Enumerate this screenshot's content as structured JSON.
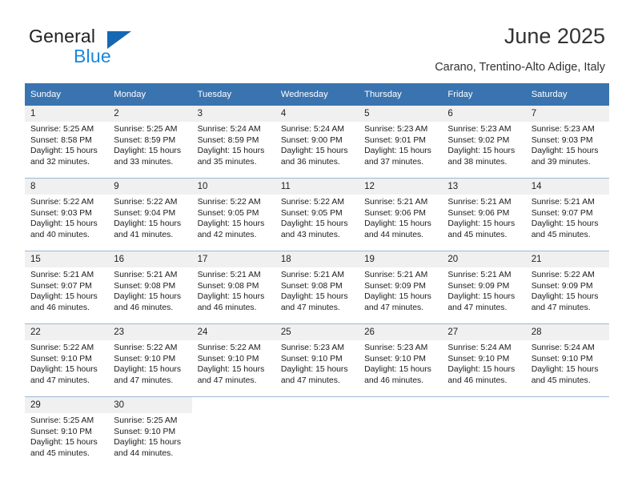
{
  "brand": {
    "name_top": "General",
    "name_bottom": "Blue",
    "triangle_color": "#1668b3",
    "blue_color": "#1a87db",
    "dark_color": "#231f20"
  },
  "header": {
    "title": "June 2025",
    "subtitle": "Carano, Trentino-Alto Adige, Italy"
  },
  "theme": {
    "header_blue": "#3a74b0",
    "daynum_band": "#f0f0f0",
    "row_border": "#9fb8d4"
  },
  "labels": {
    "sunrise_prefix": "Sunrise:",
    "sunset_prefix": "Sunset:",
    "daylight_prefix": "Daylight:"
  },
  "weekdays": [
    "Sunday",
    "Monday",
    "Tuesday",
    "Wednesday",
    "Thursday",
    "Friday",
    "Saturday"
  ],
  "weeks": [
    [
      {
        "day": "1",
        "sunrise": "Sunrise: 5:25 AM",
        "sunset": "Sunset: 8:58 PM",
        "daylight1": "Daylight: 15 hours",
        "daylight2": "and 32 minutes."
      },
      {
        "day": "2",
        "sunrise": "Sunrise: 5:25 AM",
        "sunset": "Sunset: 8:59 PM",
        "daylight1": "Daylight: 15 hours",
        "daylight2": "and 33 minutes."
      },
      {
        "day": "3",
        "sunrise": "Sunrise: 5:24 AM",
        "sunset": "Sunset: 8:59 PM",
        "daylight1": "Daylight: 15 hours",
        "daylight2": "and 35 minutes."
      },
      {
        "day": "4",
        "sunrise": "Sunrise: 5:24 AM",
        "sunset": "Sunset: 9:00 PM",
        "daylight1": "Daylight: 15 hours",
        "daylight2": "and 36 minutes."
      },
      {
        "day": "5",
        "sunrise": "Sunrise: 5:23 AM",
        "sunset": "Sunset: 9:01 PM",
        "daylight1": "Daylight: 15 hours",
        "daylight2": "and 37 minutes."
      },
      {
        "day": "6",
        "sunrise": "Sunrise: 5:23 AM",
        "sunset": "Sunset: 9:02 PM",
        "daylight1": "Daylight: 15 hours",
        "daylight2": "and 38 minutes."
      },
      {
        "day": "7",
        "sunrise": "Sunrise: 5:23 AM",
        "sunset": "Sunset: 9:03 PM",
        "daylight1": "Daylight: 15 hours",
        "daylight2": "and 39 minutes."
      }
    ],
    [
      {
        "day": "8",
        "sunrise": "Sunrise: 5:22 AM",
        "sunset": "Sunset: 9:03 PM",
        "daylight1": "Daylight: 15 hours",
        "daylight2": "and 40 minutes."
      },
      {
        "day": "9",
        "sunrise": "Sunrise: 5:22 AM",
        "sunset": "Sunset: 9:04 PM",
        "daylight1": "Daylight: 15 hours",
        "daylight2": "and 41 minutes."
      },
      {
        "day": "10",
        "sunrise": "Sunrise: 5:22 AM",
        "sunset": "Sunset: 9:05 PM",
        "daylight1": "Daylight: 15 hours",
        "daylight2": "and 42 minutes."
      },
      {
        "day": "11",
        "sunrise": "Sunrise: 5:22 AM",
        "sunset": "Sunset: 9:05 PM",
        "daylight1": "Daylight: 15 hours",
        "daylight2": "and 43 minutes."
      },
      {
        "day": "12",
        "sunrise": "Sunrise: 5:21 AM",
        "sunset": "Sunset: 9:06 PM",
        "daylight1": "Daylight: 15 hours",
        "daylight2": "and 44 minutes."
      },
      {
        "day": "13",
        "sunrise": "Sunrise: 5:21 AM",
        "sunset": "Sunset: 9:06 PM",
        "daylight1": "Daylight: 15 hours",
        "daylight2": "and 45 minutes."
      },
      {
        "day": "14",
        "sunrise": "Sunrise: 5:21 AM",
        "sunset": "Sunset: 9:07 PM",
        "daylight1": "Daylight: 15 hours",
        "daylight2": "and 45 minutes."
      }
    ],
    [
      {
        "day": "15",
        "sunrise": "Sunrise: 5:21 AM",
        "sunset": "Sunset: 9:07 PM",
        "daylight1": "Daylight: 15 hours",
        "daylight2": "and 46 minutes."
      },
      {
        "day": "16",
        "sunrise": "Sunrise: 5:21 AM",
        "sunset": "Sunset: 9:08 PM",
        "daylight1": "Daylight: 15 hours",
        "daylight2": "and 46 minutes."
      },
      {
        "day": "17",
        "sunrise": "Sunrise: 5:21 AM",
        "sunset": "Sunset: 9:08 PM",
        "daylight1": "Daylight: 15 hours",
        "daylight2": "and 46 minutes."
      },
      {
        "day": "18",
        "sunrise": "Sunrise: 5:21 AM",
        "sunset": "Sunset: 9:08 PM",
        "daylight1": "Daylight: 15 hours",
        "daylight2": "and 47 minutes."
      },
      {
        "day": "19",
        "sunrise": "Sunrise: 5:21 AM",
        "sunset": "Sunset: 9:09 PM",
        "daylight1": "Daylight: 15 hours",
        "daylight2": "and 47 minutes."
      },
      {
        "day": "20",
        "sunrise": "Sunrise: 5:21 AM",
        "sunset": "Sunset: 9:09 PM",
        "daylight1": "Daylight: 15 hours",
        "daylight2": "and 47 minutes."
      },
      {
        "day": "21",
        "sunrise": "Sunrise: 5:22 AM",
        "sunset": "Sunset: 9:09 PM",
        "daylight1": "Daylight: 15 hours",
        "daylight2": "and 47 minutes."
      }
    ],
    [
      {
        "day": "22",
        "sunrise": "Sunrise: 5:22 AM",
        "sunset": "Sunset: 9:10 PM",
        "daylight1": "Daylight: 15 hours",
        "daylight2": "and 47 minutes."
      },
      {
        "day": "23",
        "sunrise": "Sunrise: 5:22 AM",
        "sunset": "Sunset: 9:10 PM",
        "daylight1": "Daylight: 15 hours",
        "daylight2": "and 47 minutes."
      },
      {
        "day": "24",
        "sunrise": "Sunrise: 5:22 AM",
        "sunset": "Sunset: 9:10 PM",
        "daylight1": "Daylight: 15 hours",
        "daylight2": "and 47 minutes."
      },
      {
        "day": "25",
        "sunrise": "Sunrise: 5:23 AM",
        "sunset": "Sunset: 9:10 PM",
        "daylight1": "Daylight: 15 hours",
        "daylight2": "and 47 minutes."
      },
      {
        "day": "26",
        "sunrise": "Sunrise: 5:23 AM",
        "sunset": "Sunset: 9:10 PM",
        "daylight1": "Daylight: 15 hours",
        "daylight2": "and 46 minutes."
      },
      {
        "day": "27",
        "sunrise": "Sunrise: 5:24 AM",
        "sunset": "Sunset: 9:10 PM",
        "daylight1": "Daylight: 15 hours",
        "daylight2": "and 46 minutes."
      },
      {
        "day": "28",
        "sunrise": "Sunrise: 5:24 AM",
        "sunset": "Sunset: 9:10 PM",
        "daylight1": "Daylight: 15 hours",
        "daylight2": "and 45 minutes."
      }
    ],
    [
      {
        "day": "29",
        "sunrise": "Sunrise: 5:25 AM",
        "sunset": "Sunset: 9:10 PM",
        "daylight1": "Daylight: 15 hours",
        "daylight2": "and 45 minutes."
      },
      {
        "day": "30",
        "sunrise": "Sunrise: 5:25 AM",
        "sunset": "Sunset: 9:10 PM",
        "daylight1": "Daylight: 15 hours",
        "daylight2": "and 44 minutes."
      },
      {
        "day": "",
        "sunrise": "",
        "sunset": "",
        "daylight1": "",
        "daylight2": ""
      },
      {
        "day": "",
        "sunrise": "",
        "sunset": "",
        "daylight1": "",
        "daylight2": ""
      },
      {
        "day": "",
        "sunrise": "",
        "sunset": "",
        "daylight1": "",
        "daylight2": ""
      },
      {
        "day": "",
        "sunrise": "",
        "sunset": "",
        "daylight1": "",
        "daylight2": ""
      },
      {
        "day": "",
        "sunrise": "",
        "sunset": "",
        "daylight1": "",
        "daylight2": ""
      }
    ]
  ]
}
